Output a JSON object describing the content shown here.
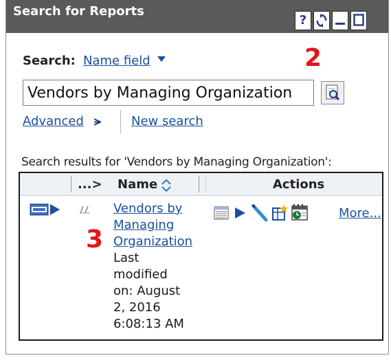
{
  "window": {
    "title": "Search for Reports"
  },
  "titlebar_buttons": {
    "help": "?",
    "refresh_icon": "refresh-icon",
    "minimize_icon": "minimize-icon",
    "maximize_icon": "maximize-icon"
  },
  "search": {
    "label": "Search:",
    "field_selector": "Name field",
    "input_value": "Vendors by Managing Organization",
    "advanced_label": "Advanced",
    "new_search_label": "New search"
  },
  "annotations": {
    "step_2": "2",
    "step_3": "3"
  },
  "results": {
    "caption": "Search results for 'Vendors by Managing Organization':",
    "columns": {
      "more_label": "...>",
      "name": "Name",
      "actions": "Actions"
    },
    "rows": [
      {
        "name_lines": [
          "Vendors by",
          "Managing",
          "Organization"
        ],
        "meta_lines": [
          "Last",
          "modified",
          "on: August",
          "2, 2016",
          "6:08:13 AM"
        ],
        "more_label": "More..."
      }
    ]
  },
  "colors": {
    "titlebar": "#5a5a5a",
    "link": "#1a4f9c",
    "annotation": "#e8141a"
  }
}
